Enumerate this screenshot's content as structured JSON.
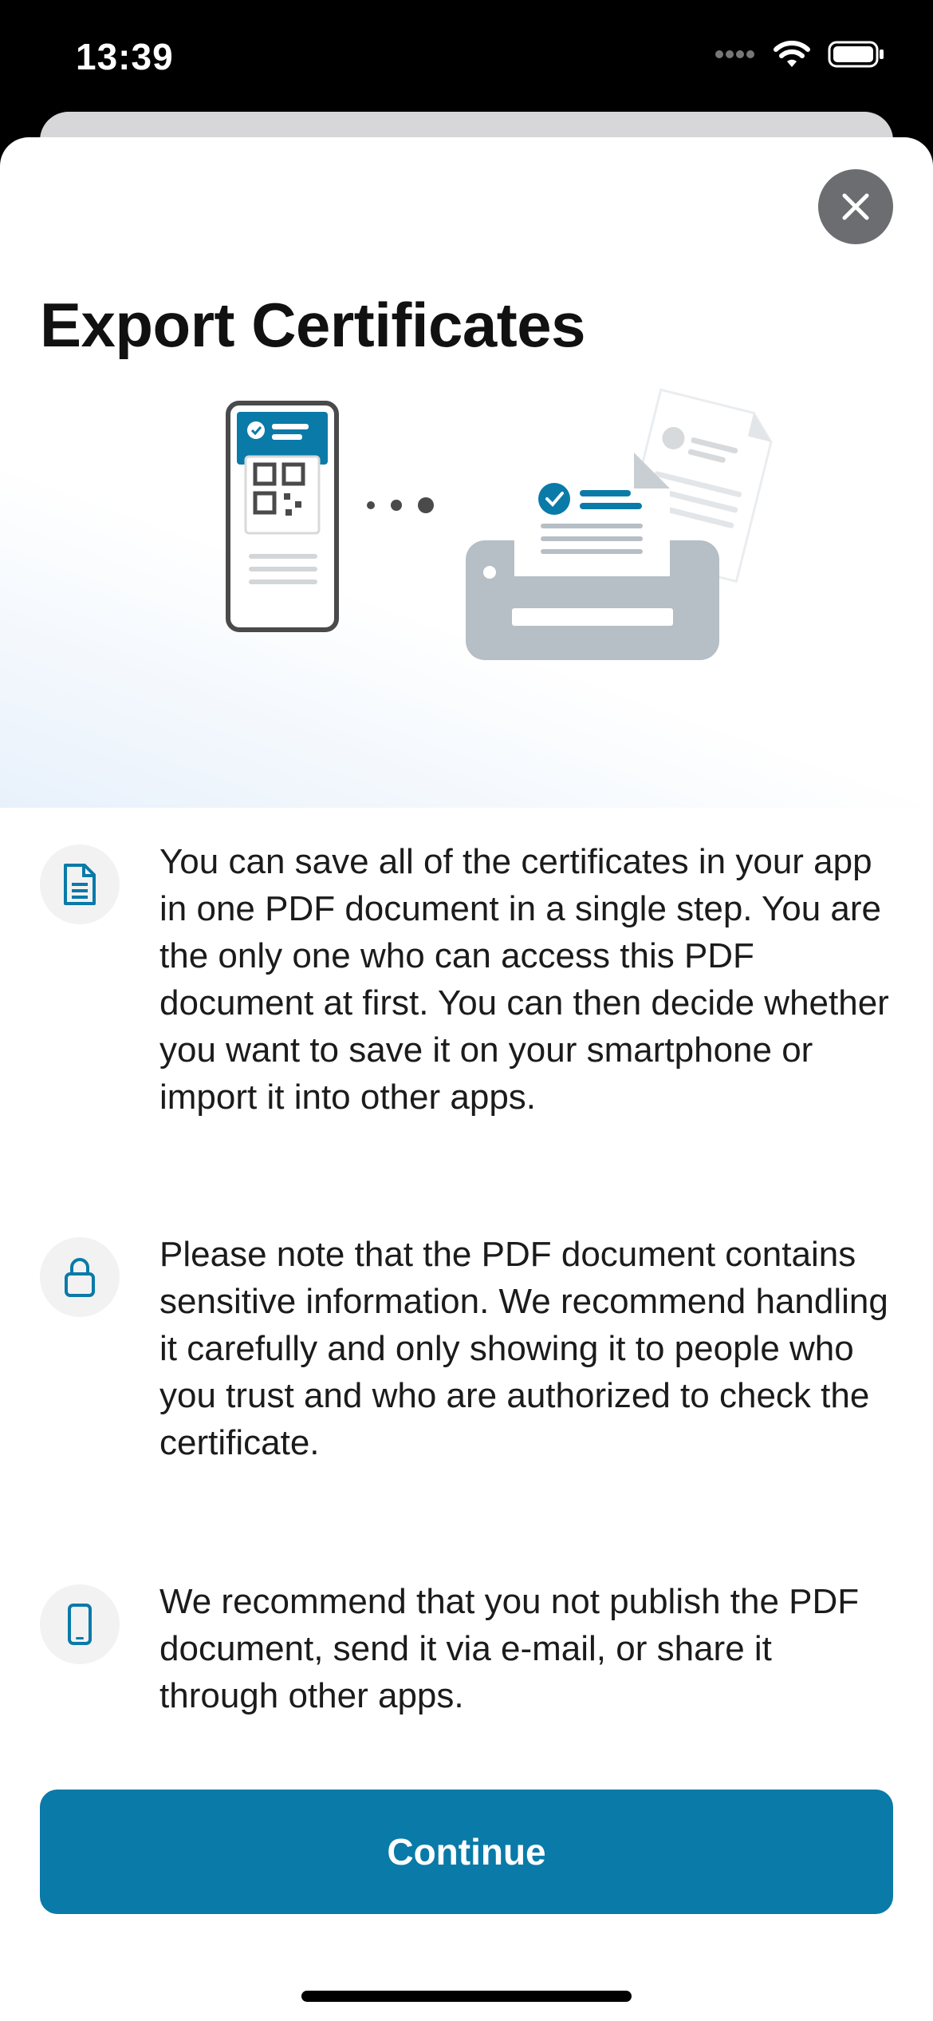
{
  "status_bar": {
    "time": "13:39"
  },
  "sheet": {
    "title": "Export Certificates",
    "close_icon": "close-icon",
    "info_items": [
      {
        "icon": "document-icon",
        "text": "You can save all of the certificates in your app in one PDF document in a single step. You are the only one who can access this PDF document at first. You can then decide whether you want to save it on your smartphone or import it into other apps."
      },
      {
        "icon": "lock-icon",
        "text": "Please note that the PDF document contains sensitive information. We recommend handling it carefully and only showing it to people who you trust and who are authorized to check the certificate."
      },
      {
        "icon": "smartphone-icon",
        "text": "We recommend that you not publish the PDF document, send it via e-mail, or share it through other apps."
      }
    ],
    "continue_label": "Continue"
  },
  "colors": {
    "accent": "#0a7aa8",
    "printer": "#b6bec6",
    "icon_dark": "#4a4a4a"
  }
}
